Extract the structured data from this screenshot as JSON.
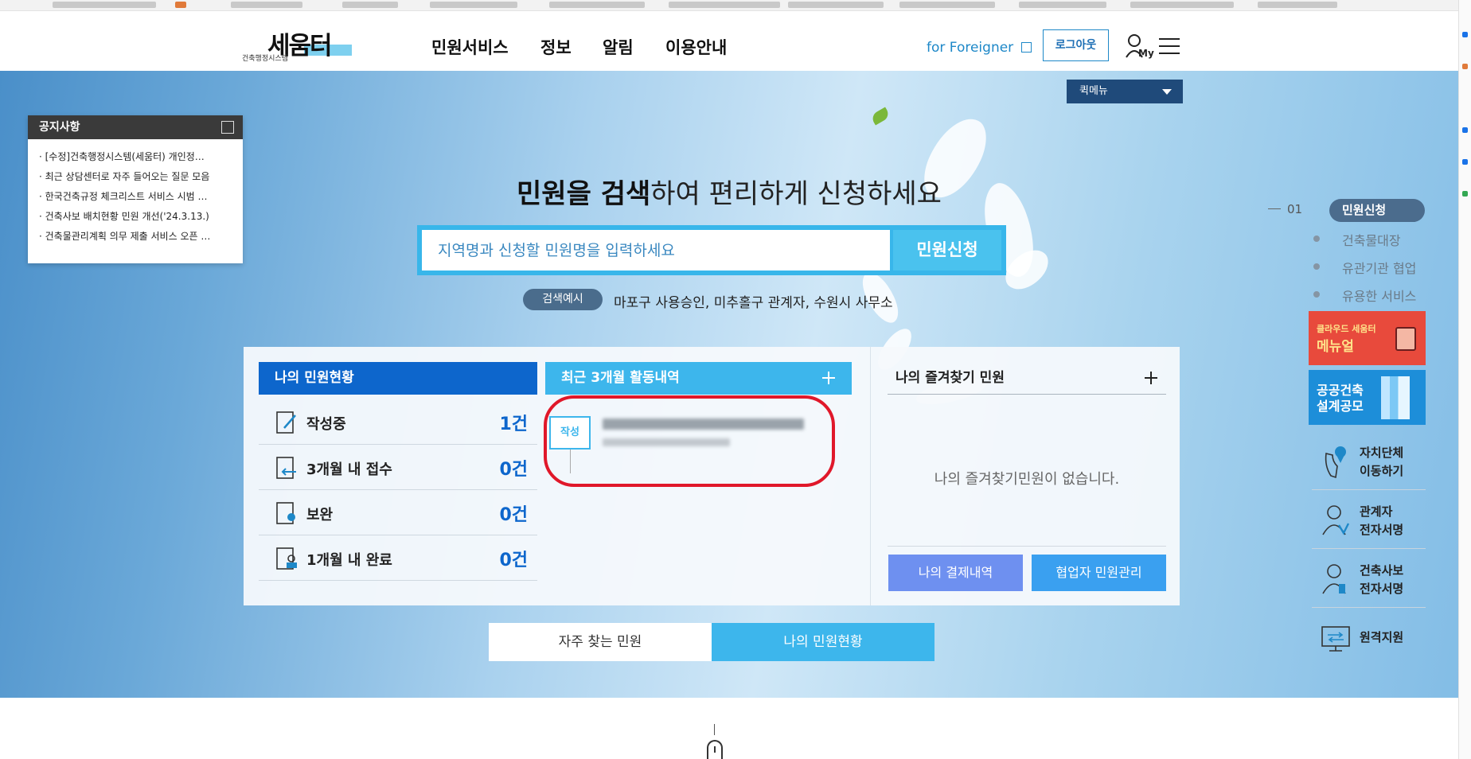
{
  "header": {
    "logo_main": "세움터",
    "logo_sub": "건축행정시스템",
    "nav": [
      "민원서비스",
      "정보",
      "알림",
      "이용안내"
    ],
    "foreigner": "for Foreigner",
    "logout": "로그아웃",
    "my": "My"
  },
  "quick_menu": {
    "label": "퀵메뉴"
  },
  "notice": {
    "title": "공지사항",
    "items": [
      "· [수정]건축행정시스템(세움터) 개인정…",
      "· 최근 상담센터로 자주 들어오는 질문 모음",
      "· 한국건축규정 체크리스트 서비스 시범 …",
      "· 건축사보 배치현황 민원 개선('24.3.13.)",
      "· 건축물관리계획 의무 제출 서비스 오픈 …"
    ]
  },
  "hero": {
    "headline_bold": "민원을 검색",
    "headline_rest": "하여 편리하게 신청하세요",
    "search_placeholder": "지역명과 신청할 민원명을 입력하세요",
    "search_button": "민원신청",
    "example_badge": "검색예시",
    "example_text": "마포구 사용승인, 미추홀구 관계자, 수원시 사무소"
  },
  "my_status": {
    "title": "나의 민원현황",
    "rows": [
      {
        "label": "작성중",
        "value": "1건"
      },
      {
        "label": "3개월 내 접수",
        "value": "0건"
      },
      {
        "label": "보완",
        "value": "0건"
      },
      {
        "label": "1개월 내 완료",
        "value": "0건"
      }
    ]
  },
  "recent": {
    "title": "최근 3개월 활동내역",
    "tag": "작성"
  },
  "favorites": {
    "title": "나의 즐겨찾기 민원",
    "empty": "나의 즐겨찾기민원이 없습니다.",
    "btn_payment": "나의 결제내역",
    "btn_partner": "협업자 민원관리"
  },
  "tabs": [
    "자주 찾는 민원",
    "나의 민원현황"
  ],
  "side_nav": {
    "num": "01",
    "active": "민원신청",
    "items": [
      "건축물대장",
      "유관기관 협업",
      "유용한 서비스"
    ],
    "banner_red": {
      "line1": "클라우드 세움터",
      "line2": "메뉴얼"
    },
    "banner_blue": {
      "line1": "공공건축",
      "line2": "설계공모"
    },
    "links": [
      {
        "line1": "자치단체",
        "line2": "이동하기"
      },
      {
        "line1": "관계자",
        "line2": "전자서명"
      },
      {
        "line1": "건축사보",
        "line2": "전자서명"
      },
      {
        "line1": "원격지원",
        "line2": ""
      }
    ]
  },
  "colors": {
    "primary_blue": "#0d66cc",
    "sky_blue": "#3db6ec",
    "highlight_red": "#e0182a",
    "navy": "#1f4a7a"
  }
}
